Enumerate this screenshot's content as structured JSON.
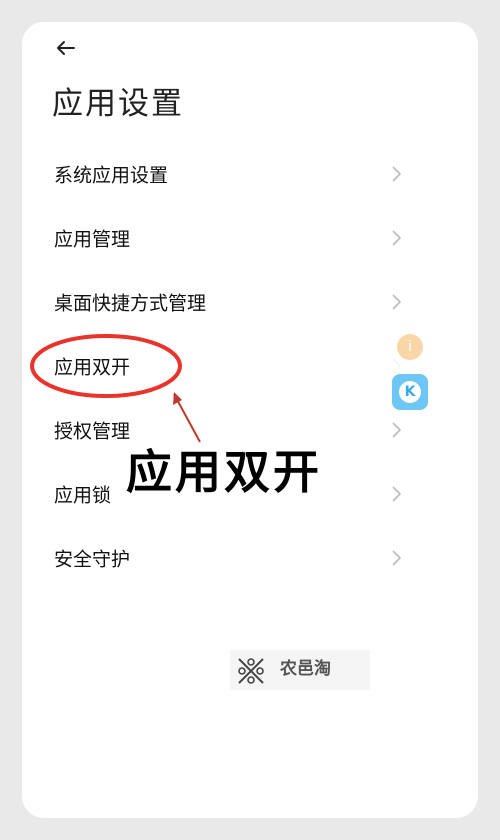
{
  "header": {
    "back_icon": "arrow-left-icon",
    "title": "应用设置"
  },
  "menu": {
    "items": [
      {
        "label": "系统应用设置",
        "icon": "chevron-right-icon"
      },
      {
        "label": "应用管理",
        "icon": "chevron-right-icon"
      },
      {
        "label": "桌面快捷方式管理",
        "icon": "chevron-right-icon"
      },
      {
        "label": "应用双开",
        "icon": "chevron-right-icon",
        "highlighted": true
      },
      {
        "label": "授权管理",
        "icon": "chevron-right-icon"
      },
      {
        "label": "应用锁",
        "icon": "chevron-right-icon"
      },
      {
        "label": "安全守护",
        "icon": "chevron-right-icon"
      }
    ]
  },
  "floating": {
    "tip_icon": "info-icon",
    "tip_glyph": "i",
    "k_icon": "k-app-icon",
    "k_letter": "K"
  },
  "annotation": {
    "caption": "应用双开",
    "highlight_color": "#e8342a",
    "arrow_color": "#c0392b"
  },
  "watermark": {
    "text": "农邑淘",
    "logo_icon": "nongyitao-logo-icon"
  }
}
